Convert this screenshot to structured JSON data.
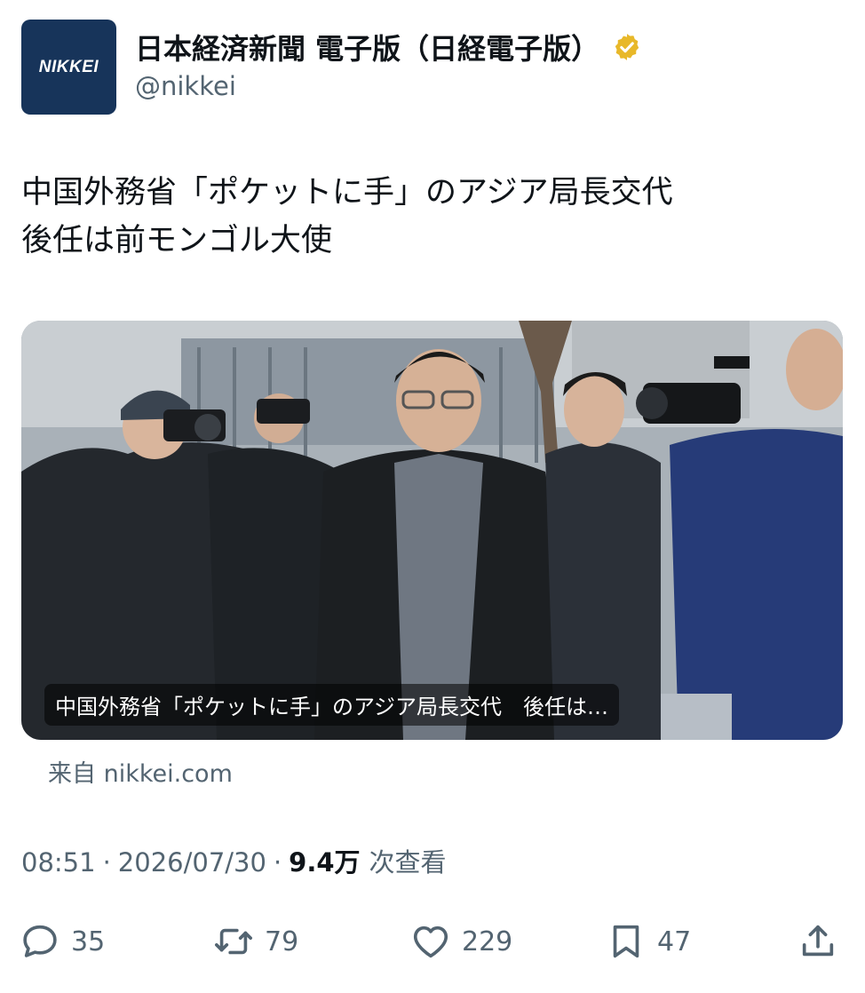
{
  "account": {
    "avatar_text": "NIKKEI",
    "display_name": "日本経済新聞 電子版（日経電子版）",
    "handle": "@nikkei",
    "verified_color": "#e8b829"
  },
  "tweet": {
    "text_lines": [
      "中国外務省「ポケットに手」のアジア局長交代",
      "後任は前モンゴル大使"
    ]
  },
  "card": {
    "caption": "中国外務省「ポケットに手」のアジア局長交代　後任は…",
    "source": "来自 nikkei.com"
  },
  "meta": {
    "time": "08:51",
    "date": "2026/07/30",
    "separator": "·",
    "views_count": "9.4万",
    "views_label": "次查看"
  },
  "actions": {
    "reply": {
      "icon": "reply-icon",
      "count": "35"
    },
    "retweet": {
      "icon": "retweet-icon",
      "count": "79"
    },
    "like": {
      "icon": "heart-icon",
      "count": "229"
    },
    "bookmark": {
      "icon": "bookmark-icon",
      "count": "47"
    },
    "share": {
      "icon": "share-icon"
    }
  },
  "colors": {
    "text_primary": "#0f1419",
    "text_secondary": "#536471",
    "avatar_bg": "#17345a"
  }
}
